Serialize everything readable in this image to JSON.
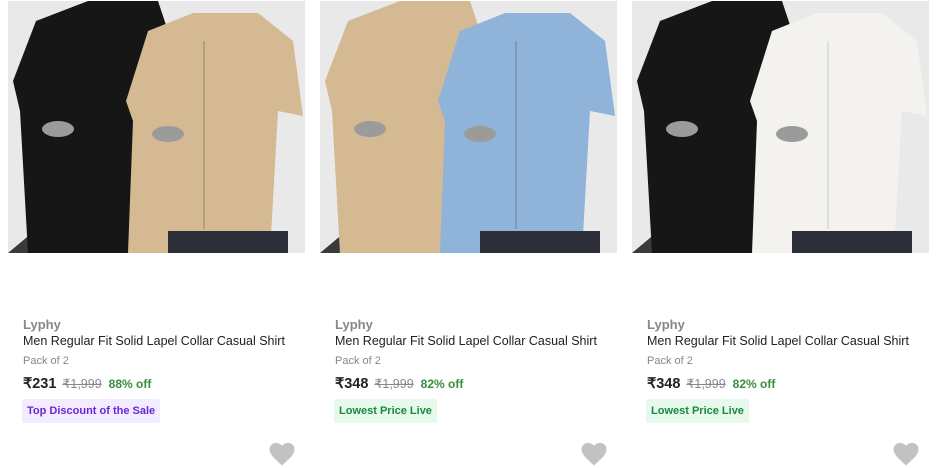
{
  "products": [
    {
      "brand": "Lyphy",
      "title": "Men Regular Fit Solid Lapel Collar Casual Shirt",
      "pack": "Pack of 2",
      "price": "₹231",
      "mrp": "₹1,999",
      "discount": "88% off",
      "badge": "Top Discount of the Sale",
      "badge_style": "purple",
      "shirt_left_color": "#161616",
      "shirt_right_color": "#d4b992",
      "wishlist_icon": "heart-icon"
    },
    {
      "brand": "Lyphy",
      "title": "Men Regular Fit Solid Lapel Collar Casual Shirt",
      "pack": "Pack of 2",
      "price": "₹348",
      "mrp": "₹1,999",
      "discount": "82% off",
      "badge": "Lowest Price Live",
      "badge_style": "green",
      "shirt_left_color": "#d4b992",
      "shirt_right_color": "#8fb3d9",
      "wishlist_icon": "heart-icon"
    },
    {
      "brand": "Lyphy",
      "title": "Men Regular Fit Solid Lapel Collar Casual Shirt",
      "pack": "Pack of 2",
      "price": "₹348",
      "mrp": "₹1,999",
      "discount": "82% off",
      "badge": "Lowest Price Live",
      "badge_style": "green",
      "shirt_left_color": "#161616",
      "shirt_right_color": "#f3f2ee",
      "wishlist_icon": "heart-icon"
    }
  ],
  "colors": {
    "discount_green": "#388e3c",
    "wishlist_grey": "#c2c2c2",
    "badge_purple_text": "#6b26d9",
    "badge_green_text": "#188a3b"
  }
}
